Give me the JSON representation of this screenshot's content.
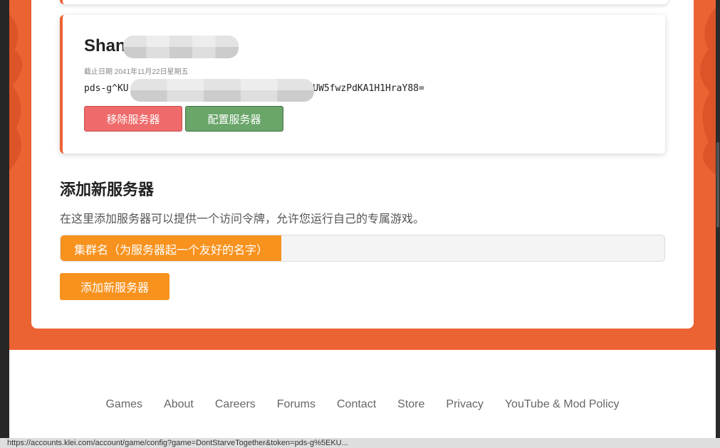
{
  "server_card": {
    "name": "Shan",
    "expiry": "截止日期 2041年11月22日星期五",
    "token": "pds-g^KU",
    "token_tail": "mhUW5fwzPdKA1H1HraY88=",
    "remove_label": "移除服务器",
    "configure_label": "配置服务器",
    "accent_color": "#ec6333"
  },
  "add_server": {
    "title": "添加新服务器",
    "description": "在这里添加服务器可以提供一个访问令牌，允许您运行自己的专属游戏。",
    "cluster_label": "集群名（为服务器起一个友好的名字）",
    "cluster_value": "",
    "add_button_label": "添加新服务器",
    "button_color": "#f7921e"
  },
  "footer": {
    "links": [
      "Games",
      "About",
      "Careers",
      "Forums",
      "Contact",
      "Store",
      "Privacy",
      "YouTube & Mod Policy"
    ]
  },
  "status_bar": {
    "url": "https://accounts.klei.com/account/game/config?game=DontStarveTogether&token=pds-g%5EKU..."
  }
}
